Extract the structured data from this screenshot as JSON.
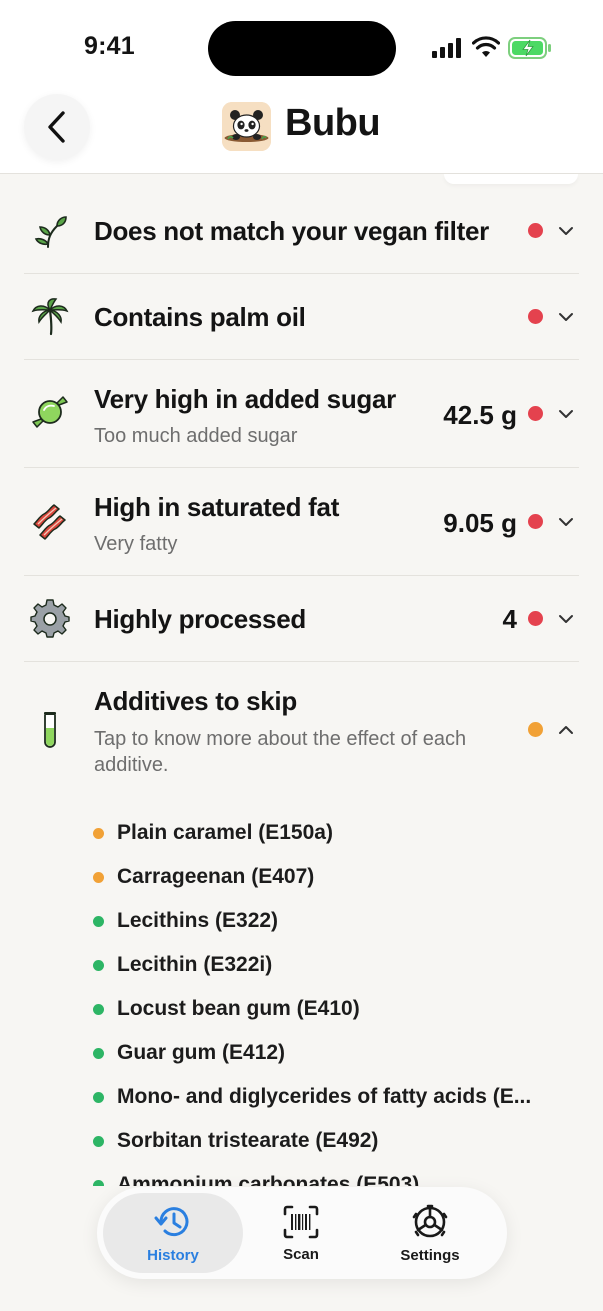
{
  "status_bar": {
    "time": "9:41"
  },
  "header": {
    "title": "Bubu",
    "back_icon": "chevron-left-icon",
    "logo_icon": "panda-logo-icon"
  },
  "rows": [
    {
      "icon": "sprout-icon",
      "title": "Does not match your vegan filter",
      "subtitle": "",
      "value": "",
      "status": "bad",
      "expanded": false
    },
    {
      "icon": "palm-tree-icon",
      "title": "Contains palm oil",
      "subtitle": "",
      "value": "",
      "status": "bad",
      "expanded": false
    },
    {
      "icon": "candy-icon",
      "title": "Very high in added sugar",
      "subtitle": "Too much added sugar",
      "value": "42.5 g",
      "status": "bad",
      "expanded": false
    },
    {
      "icon": "bacon-icon",
      "title": "High in saturated fat",
      "subtitle": "Very fatty",
      "value": "9.05 g",
      "status": "bad",
      "expanded": false
    },
    {
      "icon": "gear-icon",
      "title": "Highly processed",
      "subtitle": "",
      "value": "4",
      "status": "bad",
      "expanded": false
    },
    {
      "icon": "test-tube-icon",
      "title": "Additives to skip",
      "subtitle": "Tap to know more about the effect of each additive.",
      "value": "",
      "status": "moderate",
      "expanded": true
    }
  ],
  "additives": [
    {
      "label": "Plain caramel (E150a)",
      "status": "moderate"
    },
    {
      "label": "Carrageenan (E407)",
      "status": "moderate"
    },
    {
      "label": "Lecithins (E322)",
      "status": "good"
    },
    {
      "label": "Lecithin (E322i)",
      "status": "good"
    },
    {
      "label": "Locust bean gum (E410)",
      "status": "good"
    },
    {
      "label": "Guar gum (E412)",
      "status": "good"
    },
    {
      "label": "Mono- and diglycerides of fatty acids (E...",
      "status": "good"
    },
    {
      "label": "Sorbitan tristearate (E492)",
      "status": "good"
    },
    {
      "label": "Ammonium carbonates (E503)",
      "status": "good"
    }
  ],
  "colors": {
    "bad": "#e4424e",
    "moderate": "#f1a136",
    "good": "#2db565",
    "accent": "#2a7fe0"
  },
  "tabbar": {
    "history": {
      "label": "History",
      "icon": "history-icon"
    },
    "scan": {
      "label": "Scan",
      "icon": "barcode-scan-icon"
    },
    "settings": {
      "label": "Settings",
      "icon": "settings-gear-icon"
    }
  }
}
